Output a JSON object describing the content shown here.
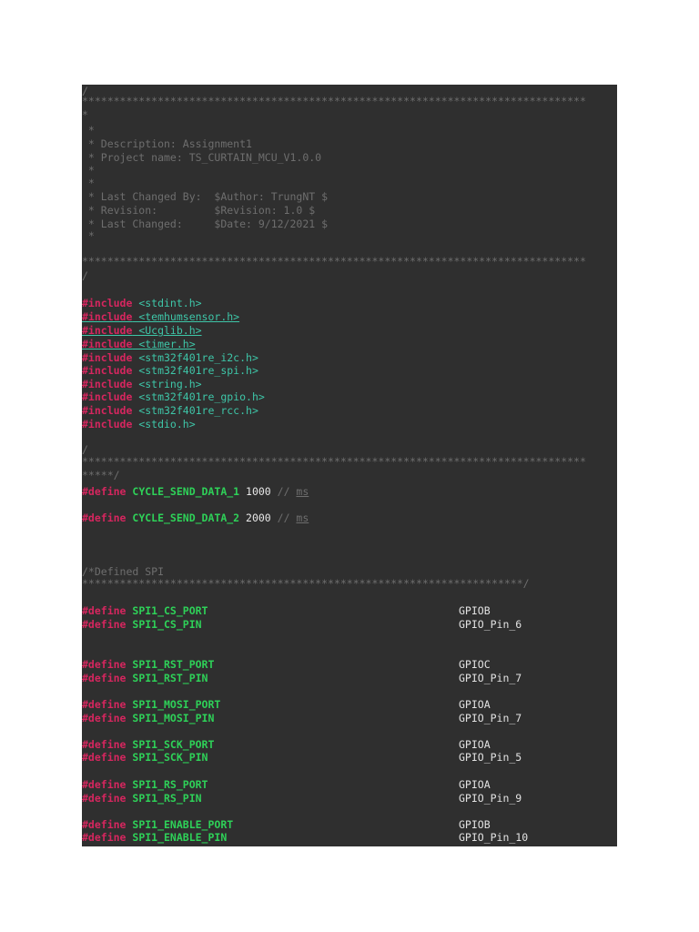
{
  "header_comment": {
    "open": "/",
    "stars_line": "********************************************************************************",
    "star": "*",
    "blank_star": " *",
    "description": " * Description: Assignment1",
    "project_name": " * Project name: TS_CURTAIN_MCU_V1.0.0",
    "last_changed_by": " * Last Changed By:  $Author: TrungNT $",
    "revision": " * Revision:         $Revision: 1.0 $",
    "last_changed": " * Last Changed:     $Date: 9/12/2021 $",
    "close": "/"
  },
  "includes": [
    {
      "keyword": "#include",
      "header": " <stdint.h>"
    },
    {
      "keyword": "#include",
      "header": " <temhumsensor.h>"
    },
    {
      "keyword": "#include",
      "header": " <Ucglib.h>"
    },
    {
      "keyword": "#include",
      "header": " <timer.h>"
    },
    {
      "keyword": "#include",
      "header": " <stm32f401re_i2c.h>"
    },
    {
      "keyword": "#include",
      "header": " <stm32f401re_spi.h>"
    },
    {
      "keyword": "#include",
      "header": " <string.h>"
    },
    {
      "keyword": "#include",
      "header": " <stm32f401re_gpio.h>"
    },
    {
      "keyword": "#include",
      "header": " <stm32f401re_rcc.h>"
    },
    {
      "keyword": "#include",
      "header": " <stdio.h>"
    }
  ],
  "defines_comment": {
    "open": "/",
    "stars_line": "********************************************************************************",
    "close": "*****/"
  },
  "cycle_defines": [
    {
      "keyword": "#define",
      "name": " CYCLE_SEND_DATA_1",
      "value": " 1000",
      "comment": " // ",
      "unit": "ms"
    },
    {
      "keyword": "#define",
      "name": " CYCLE_SEND_DATA_2",
      "value": " 2000",
      "comment": " // ",
      "unit": "ms"
    }
  ],
  "spi_comment": {
    "title": "/*Defined SPI",
    "close": "**********************************************************************/"
  },
  "spi_defines": [
    {
      "keyword": "#define",
      "name": " SPI1_CS_PORT",
      "value": "GPIOB"
    },
    {
      "keyword": "#define",
      "name": " SPI1_CS_PIN",
      "value": "GPIO_Pin_6"
    },
    {
      "keyword": "#define",
      "name": " SPI1_RST_PORT",
      "value": "GPIOC"
    },
    {
      "keyword": "#define",
      "name": " SPI1_RST_PIN",
      "value": "GPIO_Pin_7"
    },
    {
      "keyword": "#define",
      "name": " SPI1_MOSI_PORT",
      "value": "GPIOA"
    },
    {
      "keyword": "#define",
      "name": " SPI1_MOSI_PIN",
      "value": "GPIO_Pin_7"
    },
    {
      "keyword": "#define",
      "name": " SPI1_SCK_PORT",
      "value": "GPIOA"
    },
    {
      "keyword": "#define",
      "name": " SPI1_SCK_PIN",
      "value": "GPIO_Pin_5"
    },
    {
      "keyword": "#define",
      "name": " SPI1_RS_PORT",
      "value": "GPIOA"
    },
    {
      "keyword": "#define",
      "name": " SPI1_RS_PIN",
      "value": "GPIO_Pin_9"
    },
    {
      "keyword": "#define",
      "name": " SPI1_ENABLE_PORT",
      "value": "GPIOB"
    },
    {
      "keyword": "#define",
      "name": " SPI1_ENABLE_PIN",
      "value": "GPIO_Pin_10"
    }
  ]
}
